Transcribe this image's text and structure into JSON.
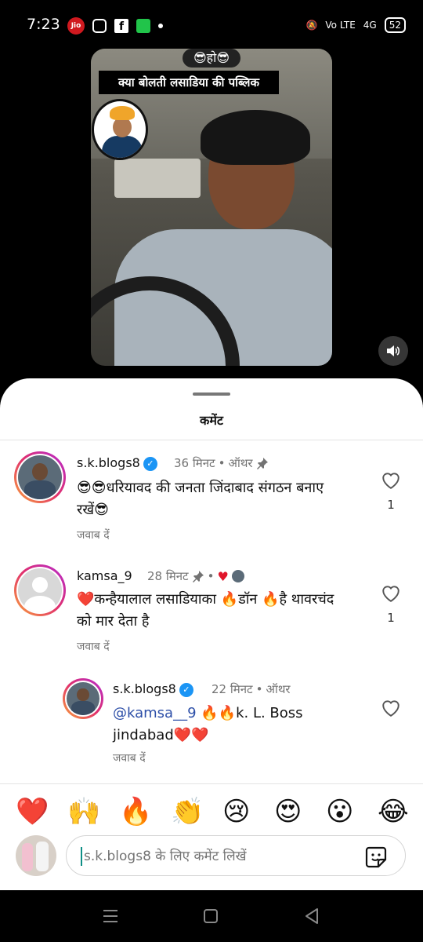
{
  "status": {
    "time": "7:23",
    "carrier": "Jio",
    "network_left": "Vo LTE",
    "network_right": "4G",
    "battery": "52"
  },
  "video": {
    "emoji_caption": "😎हो😎",
    "caption": "क्या बोलती लसाडिया की पब्लिक"
  },
  "sheet": {
    "title": "कमेंट"
  },
  "comments": [
    {
      "username": "s.k.blogs8",
      "time": "36 मिनट",
      "author_label": "ऑथर",
      "text": "😎😎धरियावद की जनता जिंदाबाद संगठन बनाए रखें😎",
      "reply_label": "जवाब दें",
      "likes": "1"
    },
    {
      "username": "kamsa_9",
      "time": "28 मिनट",
      "text": "❤️कन्हैयालाल लसाडियाका 🔥डॉन 🔥है थावरचंद को मार देता है",
      "reply_label": "जवाब दें",
      "likes": "1"
    },
    {
      "username": "s.k.blogs8",
      "time": "22 मिनट",
      "author_label": "ऑथर",
      "mention": "@kamsa__9",
      "text": " 🔥🔥k. L. Boss jindabad❤️❤️",
      "reply_label": "जवाब दें"
    }
  ],
  "reactions": [
    "❤️",
    "🙌",
    "🔥",
    "👏",
    "😢",
    "😍",
    "😮",
    "😂"
  ],
  "compose": {
    "placeholder": "s.k.blogs8 के लिए कमेंट लिखें"
  },
  "colors": {
    "verified": "#1b95f5",
    "mention": "#2d4fa8",
    "heart": "#e0162b"
  }
}
